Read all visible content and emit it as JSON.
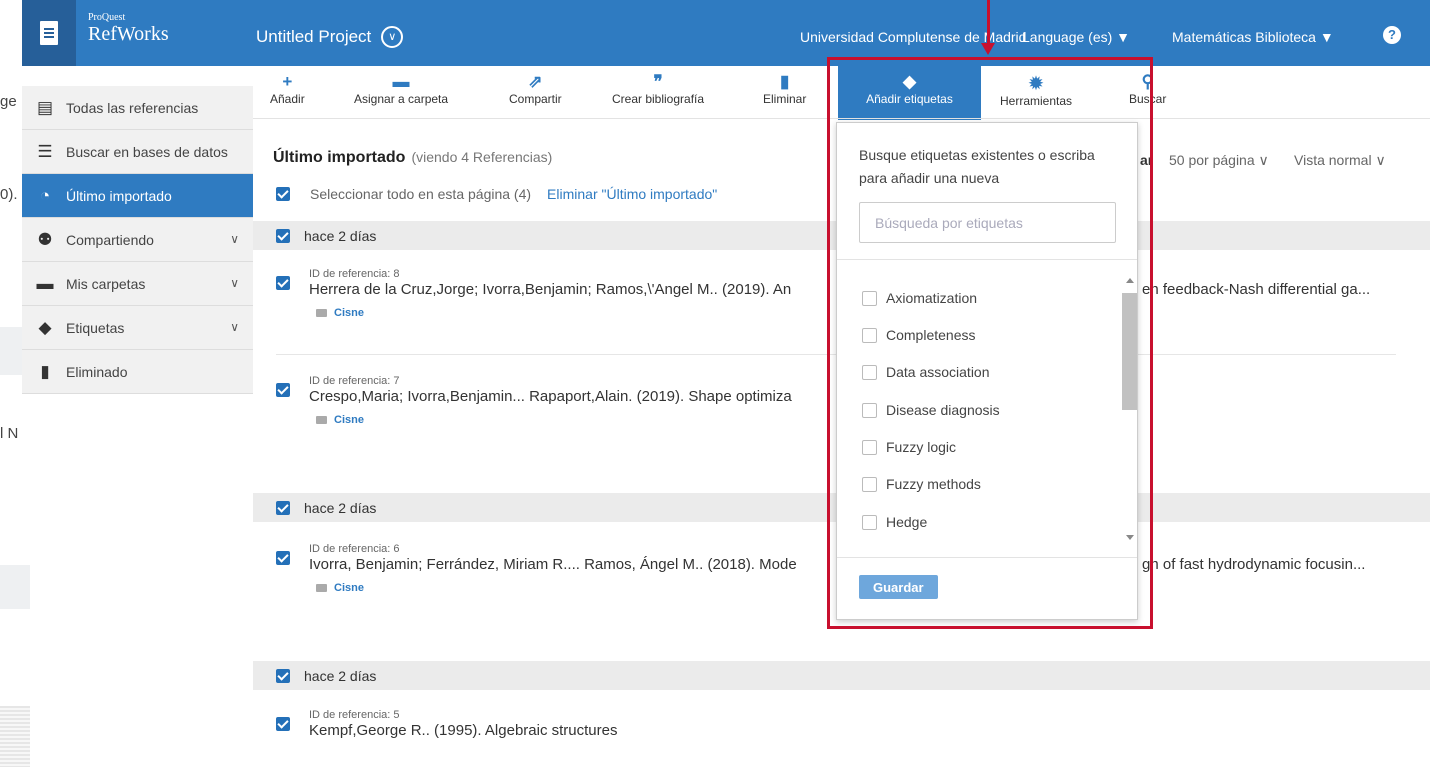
{
  "background_fragments": {
    "top": "ge",
    "mid": "0).",
    "low": "l N"
  },
  "topbar": {
    "brand_small": "ProQuest",
    "brand_big": "RefWorks",
    "project": "Untitled Project",
    "institution": "Universidad Complutense de Madrid",
    "language": "Language (es) ▼",
    "library": "Matemáticas Biblioteca ▼",
    "help": "?"
  },
  "toolbar": [
    {
      "label": "Añadir",
      "icon": "+"
    },
    {
      "label": "Asignar a carpeta",
      "icon": "▬"
    },
    {
      "label": "Compartir",
      "icon": "⇗"
    },
    {
      "label": "Crear bibliografía",
      "icon": "❞"
    },
    {
      "label": "Eliminar",
      "icon": "▮"
    },
    {
      "label": "Añadir etiquetas",
      "icon": "◆"
    },
    {
      "label": "Herramientas",
      "icon": "✹"
    },
    {
      "label": "Buscar",
      "icon": "⚲"
    }
  ],
  "sidebar": [
    {
      "label": "Todas las referencias",
      "icon": "document-icon"
    },
    {
      "label": "Buscar en bases de datos",
      "icon": "database-icon"
    },
    {
      "label": "Último importado",
      "icon": "clock-icon"
    },
    {
      "label": "Compartiendo",
      "icon": "users-icon"
    },
    {
      "label": "Mis carpetas",
      "icon": "folder-icon"
    },
    {
      "label": "Etiquetas",
      "icon": "tag-icon"
    },
    {
      "label": "Eliminado",
      "icon": "trash-icon"
    }
  ],
  "list": {
    "title": "Último importado",
    "subtitle": "(viendo 4 Referencias)",
    "select_all": "Seleccionar todo en esta página (4)",
    "delete_link": "Eliminar \"Último importado\"",
    "sort_partial": "ar",
    "per_page": "50 por página ∨",
    "view": "Vista normal ∨"
  },
  "groups": [
    "hace 2 días",
    "hace 2 días",
    "hace 2 días"
  ],
  "refs": [
    {
      "id": "ID de referencia: 8",
      "left": "Herrera de la Cruz,Jorge; Ivorra,Benjamin; Ramos,\\'Angel M.. (2019). An",
      "right": "en feedback-Nash differential ga...",
      "folder": "Cisne"
    },
    {
      "id": "ID de referencia: 7",
      "left": "Crespo,Maria; Ivorra,Benjamin... Rapaport,Alain. (2019). Shape optimiza",
      "right": "",
      "folder": "Cisne"
    },
    {
      "id": "ID de referencia: 6",
      "left": "Ivorra, Benjamin; Ferrández, Miriam R.... Ramos, Ángel M.. (2018). Mode",
      "right": "gn of fast hydrodynamic focusin...",
      "folder": "Cisne"
    },
    {
      "id": "ID de referencia: 5",
      "left": "Kempf,George R.. (1995). Algebraic structures",
      "right": "",
      "folder": ""
    }
  ],
  "tags_dropdown": {
    "hint": "Busque etiquetas existentes o escriba para añadir una nueva",
    "search_placeholder": "Búsqueda por etiquetas",
    "options": [
      "Axiomatization",
      "Completeness",
      "Data association",
      "Disease diagnosis",
      "Fuzzy logic",
      "Fuzzy methods",
      "Hedge"
    ],
    "save": "Guardar"
  },
  "colors": {
    "primary": "#2f7bc1",
    "annotation": "#c8102e"
  }
}
